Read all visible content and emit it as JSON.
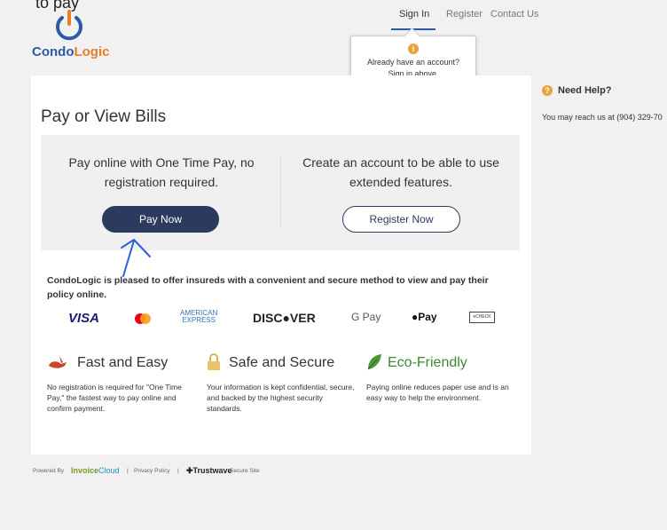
{
  "top_clip": "to pay",
  "logo": {
    "part1": "Condo",
    "part2": "Logic"
  },
  "nav": {
    "signin": "Sign In",
    "register": "Register",
    "contact": "Contact Us"
  },
  "tooltip": {
    "icon": "i",
    "line1": "Already have an account?",
    "line2": "Sign in above."
  },
  "page_title": "Pay or View Bills",
  "panel": {
    "left_text": "Pay online with One Time Pay, no registration required.",
    "right_text": "Create an account to be able to use extended features.",
    "pay_button": "Pay Now",
    "register_button": "Register Now"
  },
  "intro": "CondoLogic is pleased to offer insureds with a convenient and secure method to view and pay their policy online.",
  "payment_methods": {
    "visa": "VISA",
    "amex_line1": "AMERICAN",
    "amex_line2": "EXPRESS",
    "discover": "DISC●VER",
    "gpay": "G Pay",
    "applepay": "Pay",
    "echeck": "eCHECK"
  },
  "features": [
    {
      "title": "Fast and Easy",
      "desc": "No registration is required for \"One Time Pay,\" the fastest way to pay online and confirm payment."
    },
    {
      "title": "Safe and Secure",
      "desc": "Your information is kept confidential, secure, and backed by the highest security standards."
    },
    {
      "title": "Eco-Friendly",
      "desc": "Paying online reduces paper use and is an easy way to help the environment."
    }
  ],
  "help": {
    "icon": "?",
    "title": "Need Help?",
    "text": "You may reach us at (904) 329-70"
  },
  "footer": {
    "powered": "Powered By",
    "ic1": "Invoice",
    "ic2": "Cloud",
    "sep": "|",
    "privacy": "Privacy Policy",
    "trustwave": "Trustwave",
    "secure": "Secure Site"
  },
  "colors": {
    "brand_blue": "#2d5aa8",
    "brand_orange": "#e87e22",
    "button_navy": "#2b3a5e",
    "eco_green": "#3a8a34",
    "help_orange": "#e8a33a"
  }
}
